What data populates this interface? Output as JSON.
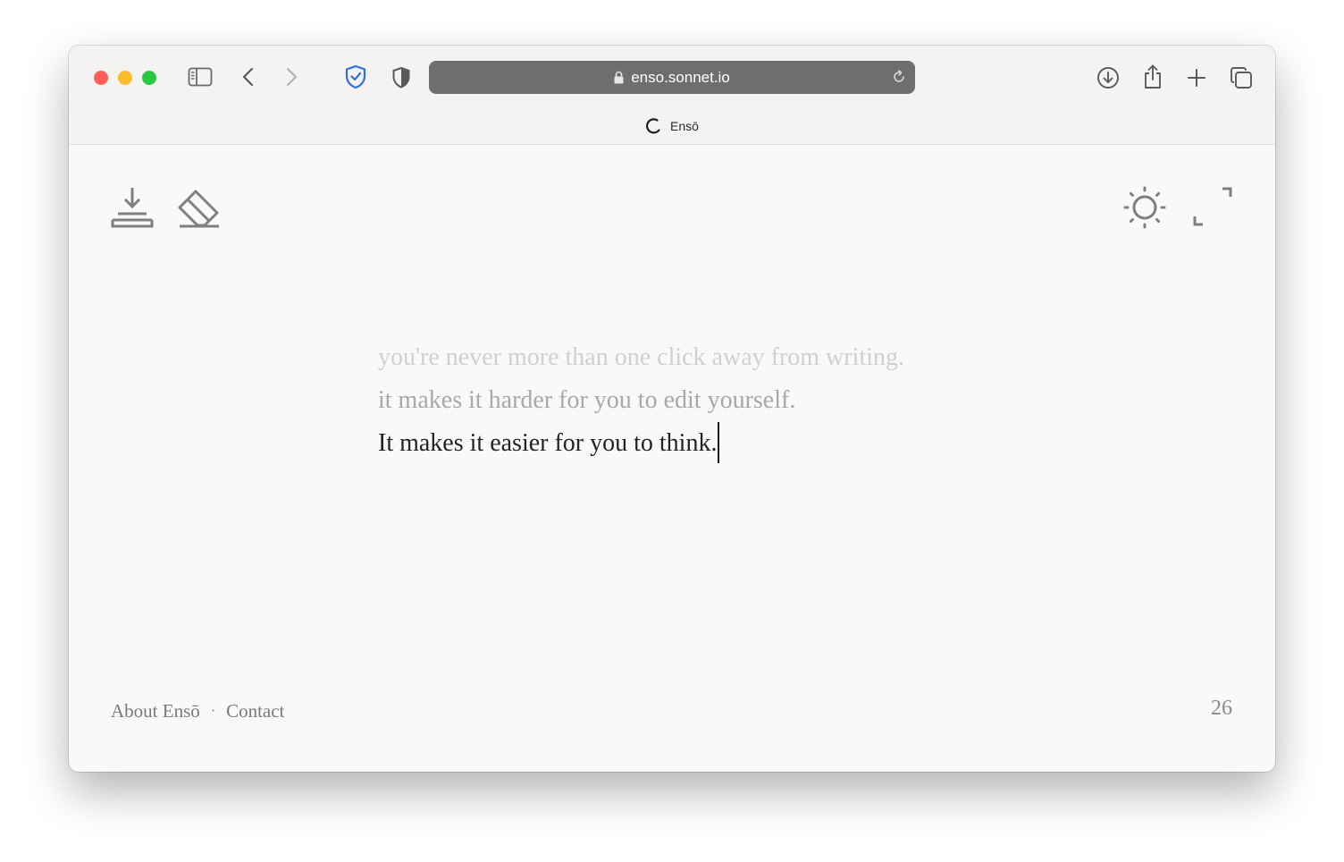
{
  "browser": {
    "address": "enso.sonnet.io",
    "tab_title": "Ensō",
    "traffic_colors": {
      "close": "#ff5f57",
      "minimize": "#febc2e",
      "zoom": "#28c840"
    }
  },
  "toolbar_icons": [
    "sidebar-icon",
    "back-icon",
    "forward-icon",
    "privacy-shield-icon",
    "half-shield-icon",
    "download-icon",
    "share-icon",
    "new-tab-icon",
    "tabs-overview-icon"
  ],
  "app": {
    "icons": [
      "save-download-icon",
      "eraser-icon",
      "theme-sun-icon",
      "fullscreen-icon"
    ],
    "lines": [
      "you're never more than one click away from writing.",
      "it makes it harder for you to edit yourself.",
      "It makes it easier for you to think."
    ],
    "footer": {
      "about": "About Ensō",
      "separator": "·",
      "contact": "Contact"
    },
    "word_count": "26"
  }
}
